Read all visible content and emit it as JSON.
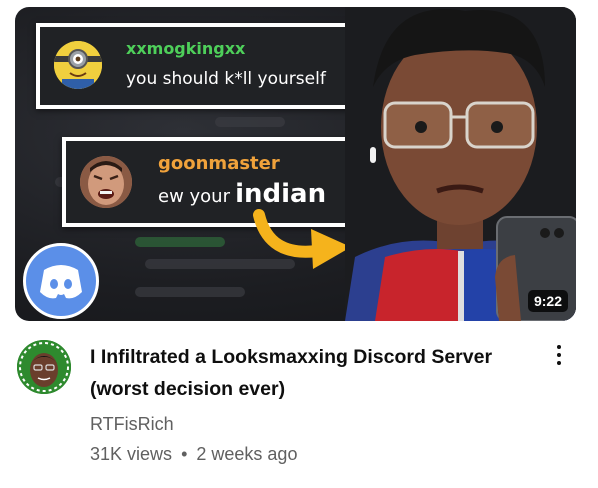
{
  "thumbnail": {
    "duration": "9:22",
    "message1": {
      "username": "xxmogkingxx",
      "text": "you should k*ll yourself",
      "username_color": "#4ecf5a"
    },
    "message2": {
      "username": "goonmaster",
      "text_prefix": "ew your",
      "text_emphasis": "indian",
      "username_color": "#f0a23b"
    },
    "arrow_color": "#f5b31c",
    "discord_color": "#5b8fe8"
  },
  "video": {
    "title": "I Infiltrated a Looksmaxxing Discord Server (worst decision ever)",
    "channel": "RTFisRich",
    "views": "31K views",
    "separator": "•",
    "age": "2 weeks ago"
  }
}
